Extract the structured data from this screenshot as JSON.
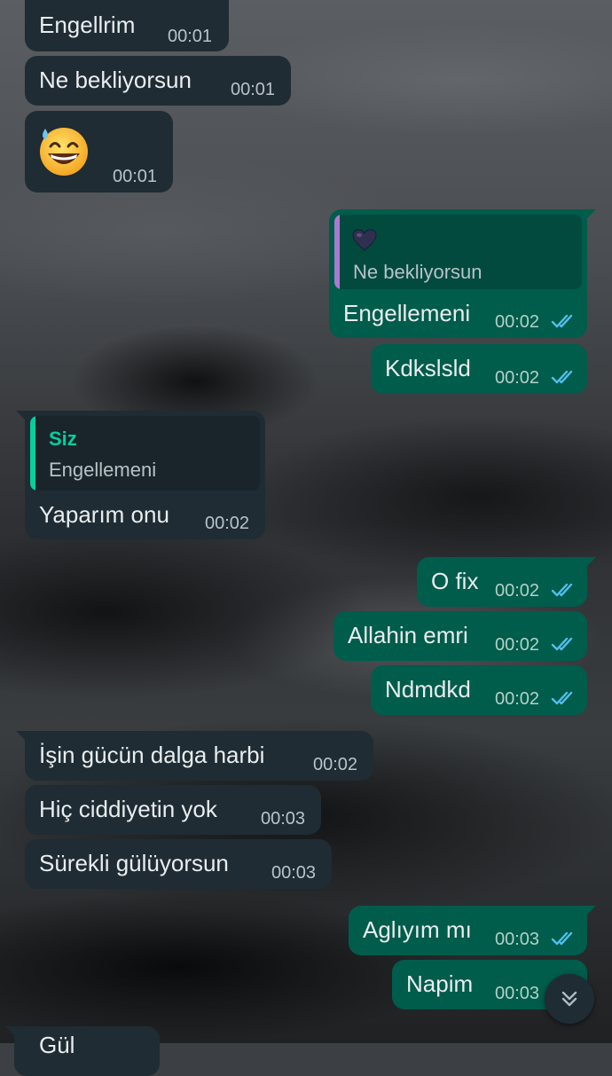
{
  "messages": [
    {
      "dir": "in",
      "text": "Engellrim",
      "time": "00:01"
    },
    {
      "dir": "in",
      "text": "Ne bekliyorsun",
      "time": "00:01"
    },
    {
      "dir": "in",
      "emoji": "grinning-sweat-emoji",
      "time": "00:01"
    },
    {
      "dir": "out",
      "quote": {
        "icon": "dark-heart-icon",
        "text": "Ne bekliyorsun"
      },
      "text": "Engellemeni",
      "time": "00:02",
      "status": "read"
    },
    {
      "dir": "out",
      "text": "Kdkslsld",
      "time": "00:02",
      "status": "read"
    },
    {
      "dir": "in",
      "quote": {
        "name": "Siz",
        "text": "Engellemeni"
      },
      "text": "Yaparım onu",
      "time": "00:02"
    },
    {
      "dir": "out",
      "text": "O fix",
      "time": "00:02",
      "status": "read"
    },
    {
      "dir": "out",
      "text": "Allahin emri",
      "time": "00:02",
      "status": "read"
    },
    {
      "dir": "out",
      "text": "Ndmdkd",
      "time": "00:02",
      "status": "read"
    },
    {
      "dir": "in",
      "text": "İşin gücün dalga harbi",
      "time": "00:02"
    },
    {
      "dir": "in",
      "text": "Hiç ciddiyetin yok",
      "time": "00:03"
    },
    {
      "dir": "in",
      "text": "Sürekli gülüyorsun",
      "time": "00:03"
    },
    {
      "dir": "out",
      "text": "Aglıyım mı",
      "time": "00:03",
      "status": "read"
    },
    {
      "dir": "out",
      "text": "Napim",
      "time": "00:03",
      "status": "read"
    },
    {
      "dir": "in",
      "text": "Gül",
      "time": ""
    }
  ],
  "colors": {
    "incoming": "#1f2c33",
    "outgoing": "#005c4b",
    "read_ticks": "#53bdeb",
    "quote_name": "#06cf9c",
    "quote_bar_out": "#a97bd0",
    "quote_bar_in": "#06cf9c"
  },
  "scroll_button_icon": "double-chevron-down-icon"
}
